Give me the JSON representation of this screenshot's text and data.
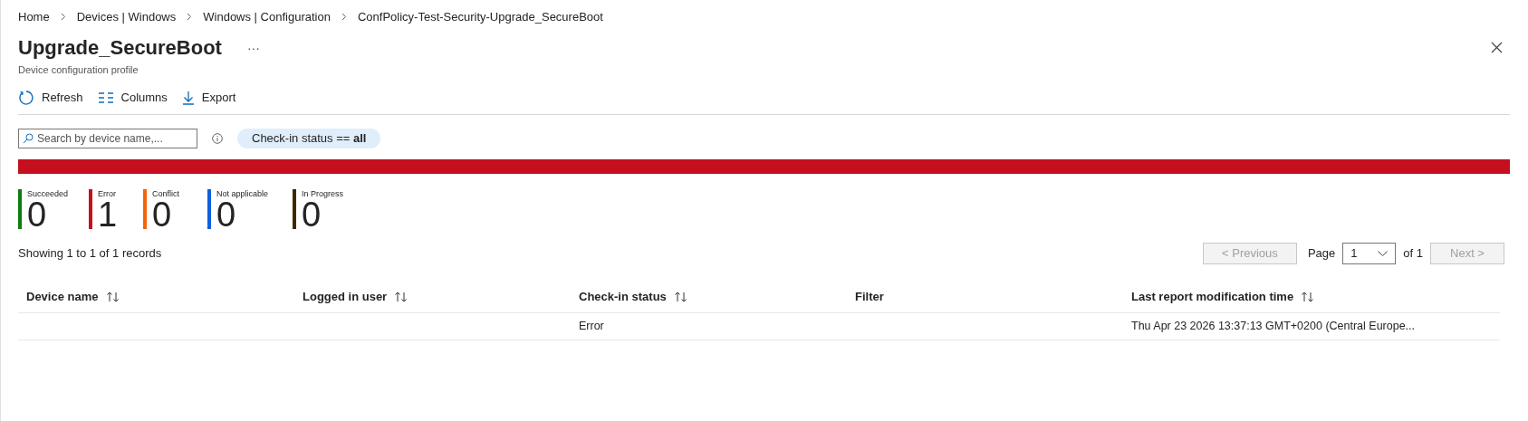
{
  "breadcrumb": [
    "Home",
    "Devices | Windows",
    "Windows | Configuration",
    "ConfPolicy-Test-Security-Upgrade_SecureBoot"
  ],
  "title": "Upgrade_SecureBoot",
  "more": "···",
  "subtitle": "Device configuration profile",
  "toolbar": [
    {
      "kind": "refresh",
      "label": "Refresh"
    },
    {
      "kind": "columns",
      "label": "Columns"
    },
    {
      "kind": "export",
      "label": "Export"
    }
  ],
  "search": {
    "placeholder": "Search by device name,..."
  },
  "filter_pill": "Check-in status == **all**",
  "stats": [
    {
      "label": "Succeeded",
      "count": "0",
      "color": "#107c10"
    },
    {
      "label": "Error",
      "count": "1",
      "color": "#c50f1f"
    },
    {
      "label": "Conflict",
      "count": "0",
      "color": "#f7630c"
    },
    {
      "label": "Not applicable",
      "count": "0",
      "color": "#0f5fdc"
    },
    {
      "label": "In Progress",
      "count": "0",
      "color": "#3b2a00"
    }
  ],
  "records_summary": "Showing 1 to 1 of 1 records",
  "pagination": {
    "previous": "< Previous",
    "page_label": "Page",
    "page": "1",
    "of": "of 1",
    "next": "Next >",
    "previous_disabled": true,
    "next_disabled": true
  },
  "table": {
    "columns": [
      {
        "label": "Device name",
        "sortable": true
      },
      {
        "label": "Logged in user",
        "sortable": true
      },
      {
        "label": "Check-in status",
        "sortable": true
      },
      {
        "label": "Filter",
        "sortable": false
      },
      {
        "label": "Last report modification time",
        "sortable": true
      }
    ],
    "rows": [
      [
        "",
        "",
        "Error",
        "",
        "Thu Apr 23 2026 13:37:13 GMT+0200 (Central Europe..."
      ]
    ]
  }
}
